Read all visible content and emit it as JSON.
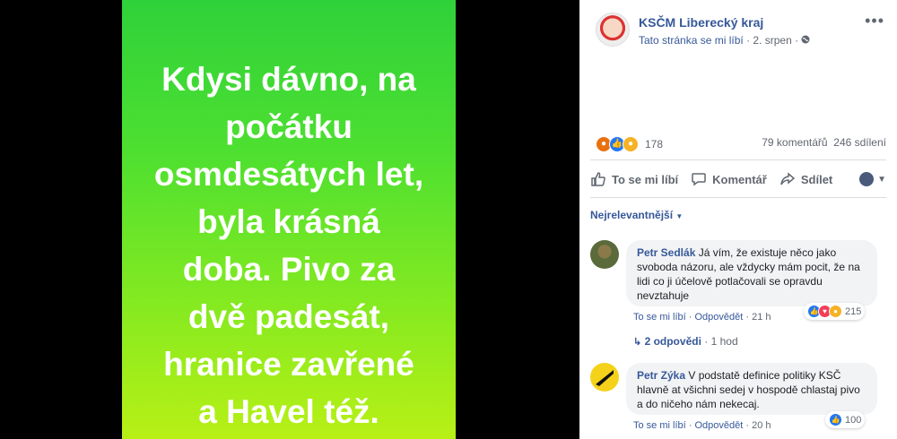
{
  "photo": {
    "lines": [
      "Kdysi dávno, na",
      "počátku",
      "osmdesátych let,",
      "byla krásná",
      "doba. Pivo za",
      "dvě padesát,",
      "hranice zavřené",
      "a Havel též."
    ]
  },
  "post": {
    "page_name": "KSČM Liberecký kraj",
    "like_page": "Tato stránka se mi líbí",
    "date": "2. srpen",
    "more": "•••",
    "reaction_count": "178",
    "comments_count": "79 komentářů",
    "shares_count": "246 sdílení"
  },
  "actions": {
    "like": "To se mi líbí",
    "comment": "Komentář",
    "share": "Sdílet"
  },
  "filter": {
    "label": "Nejrelevantnější"
  },
  "comments": [
    {
      "author": "Petr Sedlák",
      "text": "Já vím, že existuje něco jako svoboda názoru, ale vždycky mám pocit, že na lidi co ji účelově potlačovali se opravdu nevztahuje",
      "like": "To se mi líbí",
      "reply": "Odpovědět",
      "time": "21 h",
      "reactions": "215",
      "replies": "2 odpovědi",
      "replies_time": "1 hod"
    },
    {
      "author": "Petr Zýka",
      "text": "V podstatě definice politiky KSČ hlavně at všichni sedej v hospodě chlastaj pivo a do ničeho nám nekecaj.",
      "like": "To se mi líbí",
      "reply": "Odpovědět",
      "time": "20 h",
      "reactions": "100"
    }
  ],
  "colors": {
    "link": "#365899",
    "photo_top": "#2fd13a",
    "photo_bottom": "#b8f016"
  }
}
